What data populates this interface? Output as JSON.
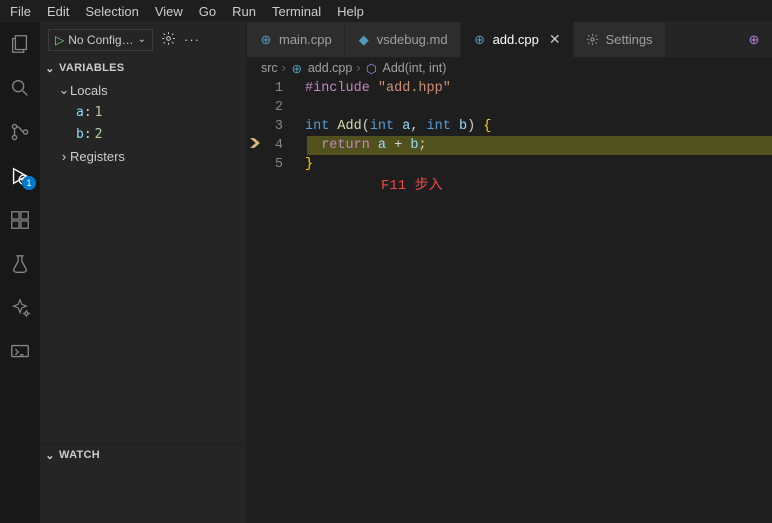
{
  "menubar": [
    "File",
    "Edit",
    "Selection",
    "View",
    "Go",
    "Run",
    "Terminal",
    "Help"
  ],
  "debugConfig": "No Config…",
  "sections": {
    "variables": "VARIABLES",
    "locals": "Locals",
    "registers": "Registers",
    "watch": "WATCH"
  },
  "vars": [
    {
      "name": "a",
      "value": "1"
    },
    {
      "name": "b",
      "value": "2"
    }
  ],
  "tabs": [
    {
      "label": "main.cpp",
      "icon": "cpp",
      "active": false
    },
    {
      "label": "vsdebug.md",
      "icon": "md",
      "active": false
    },
    {
      "label": "add.cpp",
      "icon": "cpp",
      "active": true,
      "close": true
    },
    {
      "label": "Settings",
      "icon": "gear",
      "active": false
    }
  ],
  "breadcrumb": {
    "p1": "src",
    "p2": "add.cpp",
    "p3": "Add(int, int)"
  },
  "code": {
    "l1": {
      "pp": "#include ",
      "str": "\"add.hpp\""
    },
    "l3": {
      "kw1": "int ",
      "fn": "Add",
      "po": "(",
      "kw2": "int ",
      "v1": "a",
      "cm": ", ",
      "kw3": "int ",
      "v2": "b",
      "pc": ") ",
      "br": "{"
    },
    "l4": {
      "ret": "return ",
      "v1": "a ",
      "op": "+ ",
      "v2": "b",
      "sc": ";"
    },
    "l5": {
      "br": "}"
    }
  },
  "annotation": "F11 步入",
  "badge": "1",
  "cross": "✕"
}
